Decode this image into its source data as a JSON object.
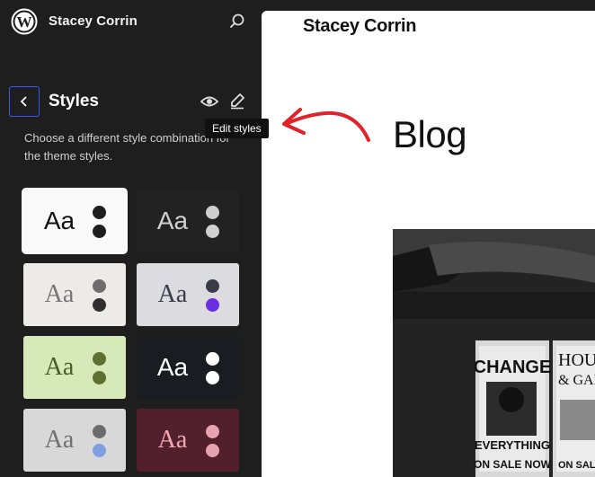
{
  "sidebar": {
    "site_name": "Stacey Corrin",
    "panel_title": "Styles",
    "description": "Choose a different style combination for the theme styles.",
    "tooltip": "Edit styles",
    "variations": [
      {
        "aa": "Aa",
        "bg": "#f9f9f9",
        "fg": "#111111",
        "dot1": "#1e1e1e",
        "dot2": "#1e1e1e",
        "font": "sans",
        "selected": true
      },
      {
        "aa": "Aa",
        "bg": "#222222",
        "fg": "#d0d0d0",
        "dot1": "#cfcfcf",
        "dot2": "#cfcfcf",
        "font": "sans",
        "selected": false
      },
      {
        "aa": "Aa",
        "bg": "#ecebe8",
        "fg": "#777777",
        "dot1": "#6d6d6d",
        "dot2": "#2f2f2f",
        "font": "serif",
        "selected": false
      },
      {
        "aa": "Aa",
        "bg": "#dcdce0",
        "fg": "#3a3a48",
        "dot1": "#3a3a48",
        "dot2": "#6a2ee0",
        "font": "serif",
        "selected": false
      },
      {
        "aa": "Aa",
        "bg": "#d7e8b9",
        "fg": "#4b5d2a",
        "dot1": "#5f6f2f",
        "dot2": "#5f6f2f",
        "font": "serif",
        "selected": false
      },
      {
        "aa": "Aa",
        "bg": "#1b1b22",
        "fg": "#ffffff",
        "dot1": "#ffffff",
        "dot2": "#ffffff",
        "font": "sans",
        "selected": false
      },
      {
        "aa": "Aa",
        "bg": "#d8d8d8",
        "fg": "#707070",
        "dot1": "#6b6b6b",
        "dot2": "#7f9fe0",
        "font": "serif",
        "selected": false
      },
      {
        "aa": "Aa",
        "bg": "#521f2c",
        "fg": "#f0a8b5",
        "dot1": "#e6a4b0",
        "dot2": "#e6a4b0",
        "font": "serif",
        "selected": false
      }
    ]
  },
  "preview": {
    "site_title": "Stacey Corrin",
    "heading": "Blog",
    "photo_sign_1": "CHANGE",
    "photo_sign_2": "EVERYTHING",
    "photo_sign_3": "ON SALE NOW",
    "photo_sign_4": "HOU",
    "photo_sign_5": "& GAR",
    "photo_sign_6": "ON SALE"
  },
  "icons": {
    "logo": "wordpress-logo-icon",
    "search": "search-icon",
    "back": "chevron-left-icon",
    "preview": "eye-icon",
    "edit": "pencil-icon",
    "annotation": "red-arrow-annotation"
  },
  "colors": {
    "sidebar_bg": "#1e1e1e",
    "accent": "#3858e9",
    "annotation": "#e0232a"
  }
}
